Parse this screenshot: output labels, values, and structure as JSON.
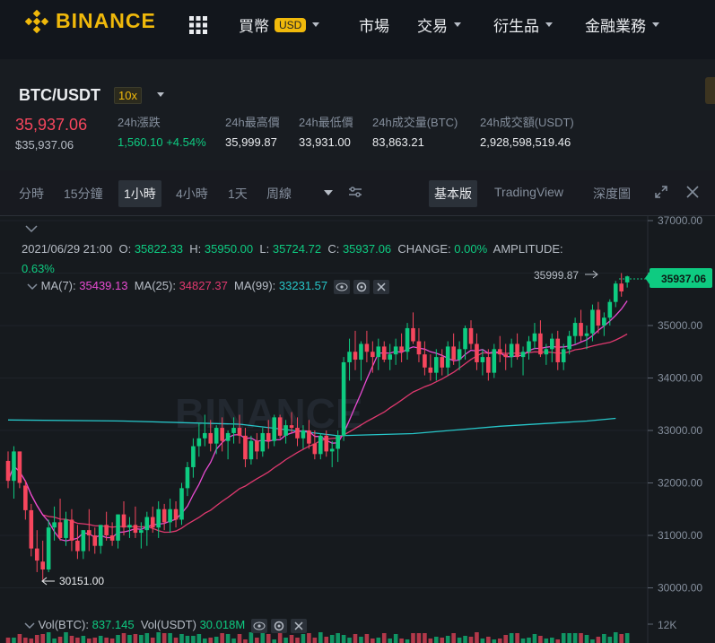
{
  "nav": {
    "logo_text": "BINANCE",
    "buy_crypto": "買幣",
    "currency_badge": "USD",
    "markets": "市場",
    "trade": "交易",
    "derivatives": "衍生品",
    "finance": "金融業務"
  },
  "ticker": {
    "pair": "BTC/USDT",
    "leverage": "10x",
    "last_price": "35,937.06",
    "last_price_usd": "$35,937.06",
    "change_label": "24h漲跌",
    "change_value": "1,560.10 +4.54%",
    "high_label": "24h最高價",
    "high_value": "35,999.87",
    "low_label": "24h最低價",
    "low_value": "33,931.00",
    "vol_btc_label": "24h成交量(BTC)",
    "vol_btc_value": "83,863.21",
    "vol_usdt_label": "24h成交額(USDT)",
    "vol_usdt_value": "2,928,598,519.46"
  },
  "toolbar": {
    "intervals": [
      "分時",
      "15分鐘",
      "1小時",
      "4小時",
      "1天",
      "周線"
    ],
    "active_interval": "1小時",
    "view_basic": "基本版",
    "view_tradingview": "TradingView",
    "view_depth": "深度圖"
  },
  "legend": {
    "date": "2021/06/29 21:00",
    "o_label": "O:",
    "o_value": "35822.33",
    "h_label": "H:",
    "h_value": "35950.00",
    "l_label": "L:",
    "l_value": "35724.72",
    "c_label": "C:",
    "c_value": "35937.06",
    "change_label": "CHANGE:",
    "change_value": "0.00%",
    "amplitude_label": "AMPLITUDE:",
    "amplitude_value": "0.63%",
    "ma7_label": "MA(7):",
    "ma7_value": "35439.13",
    "ma25_label": "MA(25):",
    "ma25_value": "34827.37",
    "ma99_label": "MA(99):",
    "ma99_value": "33231.57",
    "vol_btc_label": "Vol(BTC):",
    "vol_btc_value": "837.145",
    "vol_usdt_label": "Vol(USDT)",
    "vol_usdt_value": "30.018M"
  },
  "chart_data": {
    "type": "candlestick",
    "y_ticks": [
      "37000.00",
      "36000.00",
      "35000.00",
      "34000.00",
      "33000.00",
      "32000.00",
      "31000.00",
      "30000.00"
    ],
    "volume_tick": "12K",
    "current_price_label": "35937.06",
    "high_marker": "35999.87",
    "low_marker": "30151.00",
    "watermark": "BINANCE",
    "colors": {
      "up": "#0ecb81",
      "down": "#f6465d",
      "ma7": "#e84bd2",
      "ma25": "#e0396f",
      "ma99": "#27c6c9"
    },
    "candles": [
      [
        32420,
        32600,
        31900,
        32040
      ],
      [
        32040,
        32700,
        31700,
        32600
      ],
      [
        32600,
        32600,
        31900,
        32000
      ],
      [
        31950,
        32050,
        31300,
        31480
      ],
      [
        31480,
        31600,
        30600,
        30750
      ],
      [
        30750,
        31100,
        30300,
        30520
      ],
      [
        30500,
        30900,
        30151,
        30350
      ],
      [
        30350,
        31300,
        30300,
        31150
      ],
      [
        31150,
        31550,
        30900,
        31250
      ],
      [
        31250,
        31700,
        30900,
        30950
      ],
      [
        30950,
        31450,
        30800,
        31300
      ],
      [
        31300,
        31500,
        30700,
        30900
      ],
      [
        30900,
        31200,
        30550,
        30700
      ],
      [
        30700,
        31100,
        30550,
        31100
      ],
      [
        31100,
        31500,
        30700,
        31000
      ],
      [
        31000,
        31150,
        30650,
        30800
      ],
      [
        30800,
        31200,
        30650,
        31200
      ],
      [
        31200,
        31450,
        30900,
        31000
      ],
      [
        31000,
        31250,
        30800,
        30900
      ],
      [
        30900,
        31400,
        30750,
        31400
      ],
      [
        31400,
        31650,
        31000,
        31150
      ],
      [
        31150,
        31350,
        30950,
        31200
      ],
      [
        31200,
        31550,
        30950,
        31050
      ],
      [
        31050,
        31250,
        30750,
        31100
      ],
      [
        31100,
        31450,
        30800,
        31350
      ],
      [
        31350,
        31550,
        31050,
        31150
      ],
      [
        31150,
        31650,
        30950,
        31500
      ],
      [
        31500,
        31600,
        31100,
        31250
      ],
      [
        31250,
        31700,
        31050,
        31500
      ],
      [
        31500,
        31650,
        31150,
        31300
      ],
      [
        31300,
        32000,
        31200,
        31900
      ],
      [
        31900,
        32400,
        31750,
        32300
      ],
      [
        32300,
        32850,
        32100,
        32700
      ],
      [
        32700,
        33150,
        32500,
        32850
      ],
      [
        32850,
        33300,
        32700,
        32950
      ],
      [
        32950,
        33200,
        32600,
        32750
      ],
      [
        32750,
        33100,
        32550,
        33050
      ],
      [
        33050,
        33250,
        32600,
        32800
      ],
      [
        32800,
        33000,
        32450,
        32950
      ],
      [
        32950,
        33250,
        32750,
        33050
      ],
      [
        33050,
        33300,
        32750,
        32900
      ],
      [
        32900,
        33050,
        32300,
        32450
      ],
      [
        32450,
        32900,
        32350,
        32800
      ],
      [
        32800,
        32950,
        32450,
        32600
      ],
      [
        32600,
        33050,
        32500,
        32950
      ],
      [
        32950,
        33200,
        32650,
        32800
      ],
      [
        32800,
        33300,
        32700,
        33250
      ],
      [
        33250,
        33300,
        32850,
        32900
      ],
      [
        32900,
        33200,
        32750,
        33100
      ],
      [
        33100,
        33350,
        32950,
        33050
      ],
      [
        33050,
        33250,
        32700,
        32850
      ],
      [
        32850,
        33100,
        32650,
        33000
      ],
      [
        33000,
        33200,
        32650,
        32750
      ],
      [
        32750,
        33000,
        32450,
        32550
      ],
      [
        32550,
        32950,
        32450,
        32900
      ],
      [
        32900,
        33000,
        32500,
        32600
      ],
      [
        32600,
        32800,
        32300,
        32650
      ],
      [
        32650,
        33000,
        32400,
        32900
      ],
      [
        32900,
        34400,
        32800,
        34300
      ],
      [
        34300,
        34750,
        33950,
        34500
      ],
      [
        34500,
        34900,
        34150,
        34350
      ],
      [
        34350,
        34700,
        33950,
        34650
      ],
      [
        34650,
        34900,
        34300,
        34500
      ],
      [
        34500,
        34700,
        34100,
        34400
      ],
      [
        34400,
        34750,
        34150,
        34600
      ],
      [
        34600,
        34700,
        34300,
        34350
      ],
      [
        34350,
        34650,
        34150,
        34450
      ],
      [
        34450,
        34750,
        34250,
        34600
      ],
      [
        34600,
        34850,
        34300,
        34500
      ],
      [
        34500,
        35050,
        34350,
        34950
      ],
      [
        34950,
        35250,
        34650,
        34700
      ],
      [
        34700,
        34950,
        34300,
        34450
      ],
      [
        34450,
        34700,
        34050,
        34200
      ],
      [
        34200,
        34450,
        33950,
        34100
      ],
      [
        34100,
        34550,
        33950,
        34400
      ],
      [
        34400,
        34550,
        34050,
        34200
      ],
      [
        34200,
        34700,
        34050,
        34600
      ],
      [
        34600,
        34850,
        34250,
        34350
      ],
      [
        34350,
        34700,
        34150,
        34550
      ],
      [
        34550,
        35000,
        34350,
        34950
      ],
      [
        34950,
        35100,
        34550,
        34650
      ],
      [
        34650,
        34850,
        34150,
        34300
      ],
      [
        34300,
        34550,
        34050,
        34400
      ],
      [
        34400,
        34550,
        33950,
        34100
      ],
      [
        34100,
        34650,
        34000,
        34550
      ],
      [
        34550,
        34800,
        34300,
        34450
      ],
      [
        34450,
        34650,
        34150,
        34400
      ],
      [
        34400,
        34750,
        34200,
        34650
      ],
      [
        34650,
        34850,
        34350,
        34400
      ],
      [
        34400,
        34600,
        34050,
        34500
      ],
      [
        34500,
        34800,
        34350,
        34700
      ],
      [
        34700,
        35050,
        34550,
        34850
      ],
      [
        34850,
        35100,
        34400,
        34450
      ],
      [
        34450,
        34650,
        34250,
        34550
      ],
      [
        34550,
        34850,
        34300,
        34750
      ],
      [
        34750,
        34900,
        34150,
        34300
      ],
      [
        34300,
        34650,
        34150,
        34550
      ],
      [
        34550,
        34900,
        34450,
        34800
      ],
      [
        34800,
        35150,
        34650,
        35050
      ],
      [
        35050,
        35300,
        34700,
        34800
      ],
      [
        34800,
        35000,
        34550,
        34850
      ],
      [
        34850,
        35400,
        34700,
        35300
      ],
      [
        35300,
        35450,
        34850,
        35000
      ],
      [
        35000,
        35250,
        34800,
        35150
      ],
      [
        35150,
        35500,
        35000,
        35450
      ],
      [
        35450,
        35850,
        35350,
        35800
      ],
      [
        35800,
        36000,
        35550,
        35650
      ],
      [
        35822,
        35950,
        35724,
        35937
      ]
    ],
    "ma99": [
      [
        0,
        33200
      ],
      [
        20,
        33180
      ],
      [
        40,
        33120
      ],
      [
        57,
        32900
      ],
      [
        70,
        32940
      ],
      [
        85,
        33080
      ],
      [
        100,
        33180
      ],
      [
        105,
        33231
      ]
    ]
  }
}
